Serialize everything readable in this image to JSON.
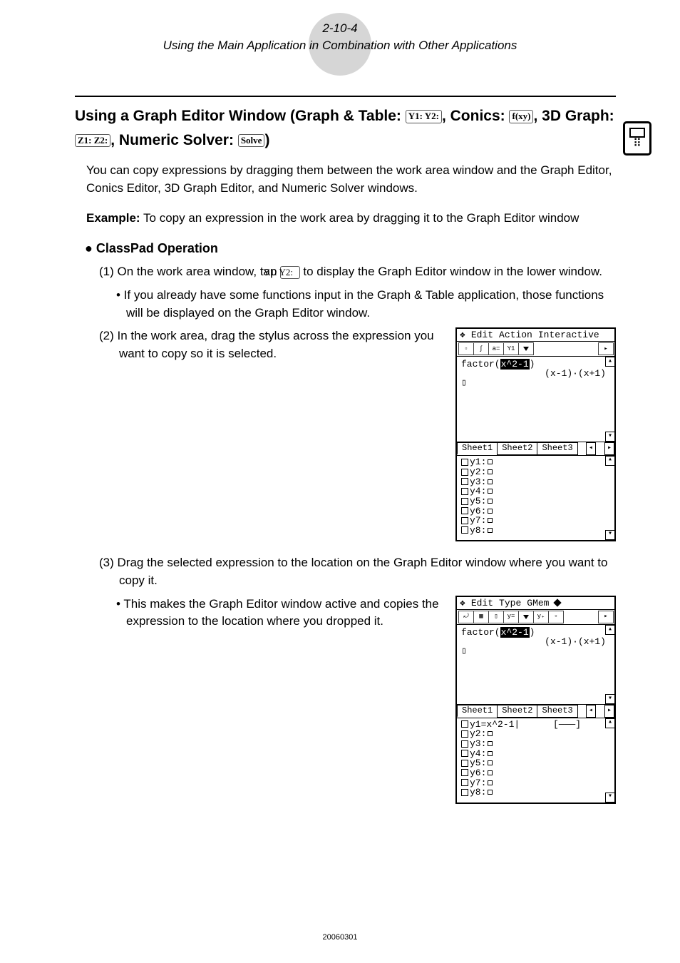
{
  "header": {
    "page_number": "2-10-4",
    "subtitle": "Using the Main Application in Combination with Other Applications"
  },
  "section": {
    "heading_part1": "Using a Graph Editor Window (Graph & Table: ",
    "heading_part2": ", Conics: ",
    "heading_part3": ", 3D Graph: ",
    "heading_part4": ", Numeric Solver: ",
    "heading_part5": ")",
    "icon_graph_table": "Y1:\nY2:",
    "icon_conics": "f(xy)",
    "icon_3d": "Z1:\nZ2:",
    "icon_solver": "Solve"
  },
  "intro": "You can copy expressions by dragging them between the work area window and the Graph Editor, Conics Editor, 3D Graph Editor, and Numeric Solver windows.",
  "example": {
    "label": "Example:",
    "text": "  To copy an expression in the work area by dragging it to the Graph Editor window"
  },
  "operation": {
    "heading": "● ClassPad Operation",
    "step1_a": "(1) On the work area window, tap ",
    "step1_b": " to display the Graph Editor window in the lower window.",
    "step1_icon": "Y1:\nY2:",
    "step1_bullet": "• If you already have some functions input in the Graph & Table application, those functions will be displayed on the Graph Editor window.",
    "step2": "(2) In the work area, drag the stylus across the expression you want to copy so it is selected.",
    "step3": "(3) Drag the selected expression to the location on the Graph Editor window where you want to copy it.",
    "step3_bullet": "• This makes the Graph Editor window active and copies the expression to the location where you dropped it."
  },
  "fig1": {
    "menu": [
      "Edit",
      "Action",
      "Interactive"
    ],
    "expr_prefix": "factor(",
    "expr_sel": "x^2-1",
    "expr_suffix": ")",
    "result": "(x-1)·(x+1)",
    "tabs": [
      "Sheet1",
      "Sheet2",
      "Sheet3"
    ],
    "ylist": [
      "y1:",
      "y2:",
      "y3:",
      "y4:",
      "y5:",
      "y6:",
      "y7:",
      "y8:"
    ]
  },
  "fig2": {
    "menu": [
      "Edit",
      "Type",
      "GMem"
    ],
    "expr_prefix": "factor(",
    "expr_sel": "x^2-1",
    "expr_suffix": ")",
    "result": "(x-1)·(x+1)",
    "tabs": [
      "Sheet1",
      "Sheet2",
      "Sheet3"
    ],
    "y1": "y1=x^2-1|",
    "graph_hint": "[———]",
    "ylist": [
      "y2:",
      "y3:",
      "y4:",
      "y5:",
      "y6:",
      "y7:",
      "y8:"
    ]
  },
  "footer": "20060301"
}
